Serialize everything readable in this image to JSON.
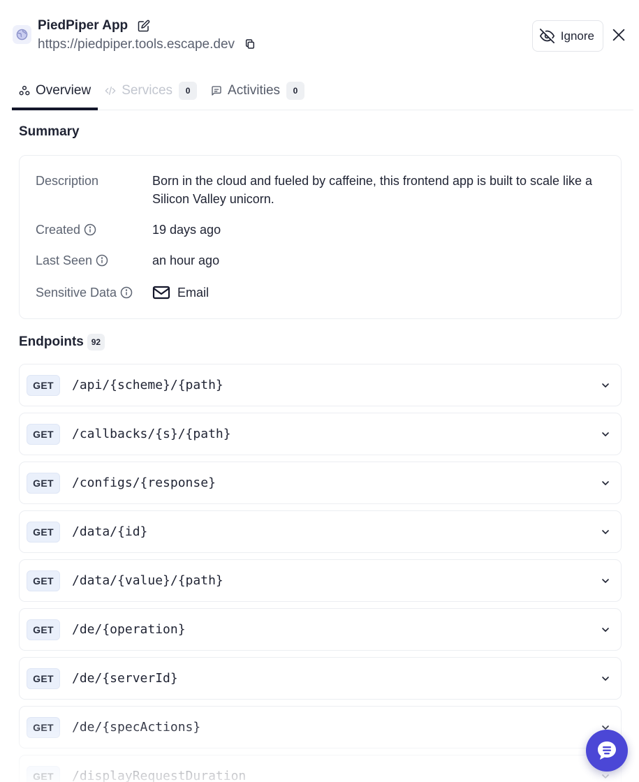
{
  "app": {
    "title": "PiedPiper App",
    "url": "https://piedpiper.tools.escape.dev"
  },
  "actions": {
    "ignore_label": "Ignore"
  },
  "tabs": [
    {
      "label": "Overview",
      "count": null,
      "state": "active"
    },
    {
      "label": "Services",
      "count": "0",
      "state": "disabled"
    },
    {
      "label": "Activities",
      "count": "0",
      "state": "normal"
    }
  ],
  "summary": {
    "title": "Summary",
    "description_label": "Description",
    "description": "Born in the cloud and fueled by caffeine, this frontend app is built to scale like a Silicon Valley unicorn.",
    "created_label": "Created",
    "created": "19 days ago",
    "last_seen_label": "Last Seen",
    "last_seen": "an hour ago",
    "sensitive_label": "Sensitive Data",
    "sensitive": "Email"
  },
  "endpoints": {
    "title": "Endpoints",
    "count": "92",
    "items": [
      {
        "method": "GET",
        "path": "/api/{scheme}/{path}"
      },
      {
        "method": "GET",
        "path": "/callbacks/{s}/{path}"
      },
      {
        "method": "GET",
        "path": "/configs/{response}"
      },
      {
        "method": "GET",
        "path": "/data/{id}"
      },
      {
        "method": "GET",
        "path": "/data/{value}/{path}"
      },
      {
        "method": "GET",
        "path": "/de/{operation}"
      },
      {
        "method": "GET",
        "path": "/de/{serverId}"
      },
      {
        "method": "GET",
        "path": "/de/{specActions}"
      },
      {
        "method": "GET",
        "path": "/displayRequestDuration"
      }
    ]
  },
  "colors": {
    "accent": "#4b47d6",
    "tab_underline": "#14172b",
    "method_bg": "#eaf0fb"
  }
}
